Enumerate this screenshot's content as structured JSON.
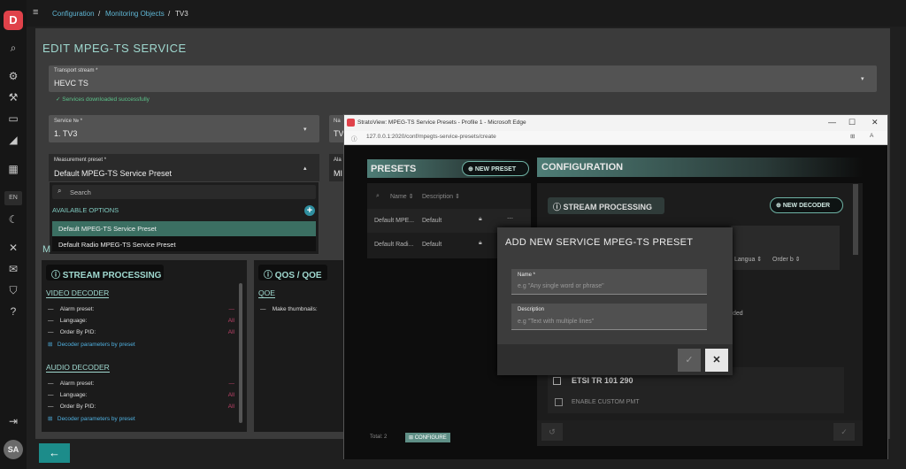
{
  "sidebar": {
    "logo": "D",
    "icons": [
      "search-icon",
      "gear-icon",
      "wrench-icon",
      "monitor-icon",
      "chart-icon",
      "grid-icon",
      "moon-icon",
      "mute-icon",
      "mail-off-icon",
      "shield-icon",
      "help-icon",
      "logout-icon"
    ],
    "glyphs": [
      "⌕",
      "⚙",
      "⚒",
      "▭",
      "◢",
      "▦",
      "☾",
      "✕",
      "✉",
      "⛉",
      "?",
      "⇥"
    ],
    "lang": "EN",
    "avatar": "SA"
  },
  "topbar": {
    "menu_glyph": "≡",
    "crumbs": [
      "Configuration",
      "Monitoring Objects",
      "TV3"
    ],
    "sep": "/"
  },
  "page": {
    "title": "EDIT MPEG-TS SERVICE",
    "transport_label": "Transport stream *",
    "transport_value": "HEVC TS",
    "success_msg": "Services downloaded successfully",
    "service_label": "Service № *",
    "service_value": "1. TV3",
    "name_label_partial": "Na",
    "name_value_partial": "TV",
    "preset_label": "Measurement preset *",
    "preset_value": "Default MPEG-TS Service Preset",
    "alarm_label_partial": "Ala",
    "alarm_value_partial": "MI",
    "search_placeholder": "Search",
    "available_options": "AVAILABLE OPTIONS",
    "options": [
      "Default MPEG-TS Service Preset",
      "Default Radio MPEG-TS Service Preset"
    ],
    "m_partial": "M",
    "back_glyph": "←"
  },
  "stream_card": {
    "title": "STREAM PROCESSING",
    "video_head": "VIDEO DECODER",
    "audio_head": "AUDIO DECODER",
    "video_rows": [
      {
        "label": "Alarm preset:",
        "value": "—"
      },
      {
        "label": "Language:",
        "value": "All"
      },
      {
        "label": "Order By PID:",
        "value": "All"
      }
    ],
    "audio_rows": [
      {
        "label": "Alarm preset:",
        "value": "—"
      },
      {
        "label": "Language:",
        "value": "All"
      },
      {
        "label": "Order By PID:",
        "value": "All"
      }
    ],
    "decoder_link": "Decoder parameters by preset"
  },
  "qos_card": {
    "title": "QOS / QOE",
    "sub": "QOE",
    "row": "Make thumbnails:"
  },
  "browser": {
    "title": "StratoView: MPEG-TS Service Presets - Profile 1 - Microsoft Edge",
    "url": "127.0.0.1:2020/conf/mpegts-service-presets/create",
    "min": "—",
    "max": "☐",
    "close": "✕",
    "presets_title": "PRESETS",
    "new_preset": "NEW PRESET",
    "col_name": "Name",
    "col_desc": "Description",
    "presets": [
      {
        "name": "Default MPE...",
        "desc": "Default"
      },
      {
        "name": "Default Radi...",
        "desc": "Default"
      }
    ],
    "total": "Total: 2",
    "configure": "CONFIGURE",
    "config_title": "CONFIGURATION",
    "stream_processing": "STREAM PROCESSING",
    "new_decoder": "NEW DECODER",
    "col_lang": "Langua",
    "col_order": "Order b",
    "added_partial": "ded",
    "etsi": "ETSI TR 101 290",
    "enable_pmt": "ENABLE CUSTOM PMT"
  },
  "modal": {
    "title": "ADD NEW SERVICE MPEG-TS PRESET",
    "name_label": "Name *",
    "name_placeholder": "e.g \"Any single word or phrase\"",
    "desc_label": "Description",
    "desc_placeholder": "e.g \"Text with multiple lines\"",
    "ok": "✓",
    "cancel": "✕"
  }
}
